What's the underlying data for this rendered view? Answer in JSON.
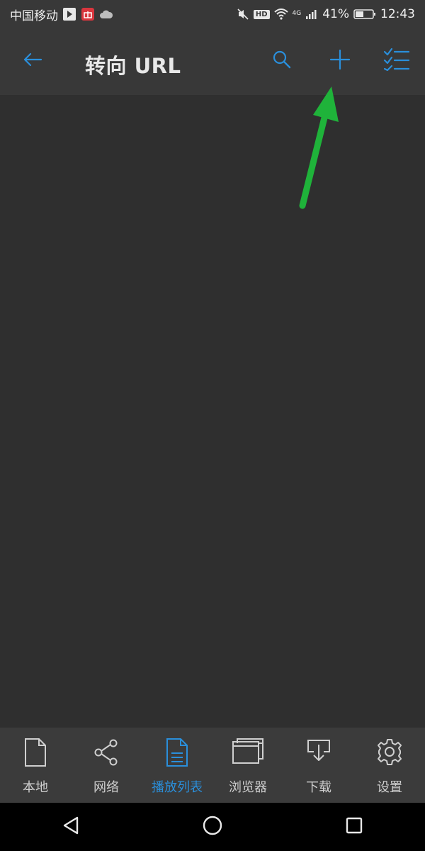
{
  "status_bar": {
    "carrier": "中国移动",
    "hd": "HD",
    "network": "4G",
    "battery": "41%",
    "time": "12:43"
  },
  "app_bar": {
    "title": "转向 URL",
    "icons": [
      "back-arrow-icon",
      "search-icon",
      "plus-icon",
      "checklist-icon"
    ]
  },
  "bottom_nav": {
    "items": [
      {
        "label": "本地",
        "icon": "file-icon",
        "active": false
      },
      {
        "label": "网络",
        "icon": "share-icon",
        "active": false
      },
      {
        "label": "播放列表",
        "icon": "document-icon",
        "active": true
      },
      {
        "label": "浏览器",
        "icon": "windows-icon",
        "active": false
      },
      {
        "label": "下载",
        "icon": "download-icon",
        "active": false
      },
      {
        "label": "设置",
        "icon": "gear-icon",
        "active": false
      }
    ]
  },
  "colors": {
    "accent": "#2a8fdb",
    "appbar": "#383838",
    "background": "#2f2f2f",
    "annotation_arrow": "#1fb33a"
  }
}
